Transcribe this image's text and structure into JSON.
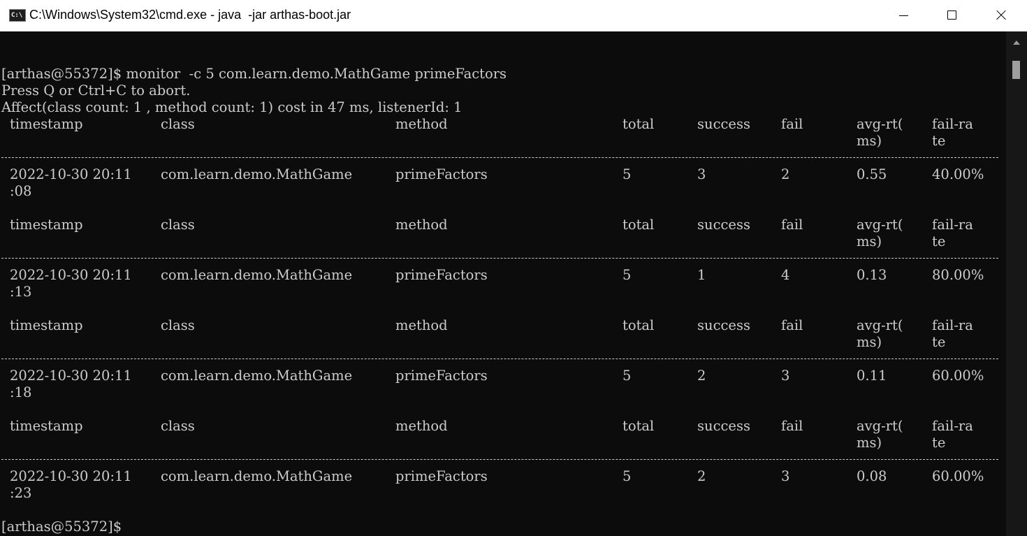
{
  "window": {
    "title": "C:\\Windows\\System32\\cmd.exe - java  -jar arthas-boot.jar",
    "icon": "cmd-icon",
    "icon_text": "C:\\"
  },
  "console": {
    "command_line": "[arthas@55372]$ monitor  -c 5 com.learn.demo.MathGame primeFactors",
    "abort_hint": "Press Q or Ctrl+C to abort.",
    "affect_line": "Affect(class count: 1 , method count: 1) cost in 47 ms, listenerId: 1",
    "headers": [
      "timestamp",
      "class",
      "method",
      "total",
      "success",
      "fail",
      "avg-rt(",
      "fail-ra"
    ],
    "headers_wrap": [
      "",
      "",
      "",
      "",
      "",
      "",
      "ms)",
      "te"
    ],
    "rows": [
      {
        "timestamp": "2022-10-30 20:11",
        "timestamp_wrap": ":08",
        "class": "com.learn.demo.MathGame",
        "method": "primeFactors",
        "total": "5",
        "success": "3",
        "fail": "2",
        "avg_rt": "0.55",
        "fail_rate": "40.00%"
      },
      {
        "timestamp": "2022-10-30 20:11",
        "timestamp_wrap": ":13",
        "class": "com.learn.demo.MathGame",
        "method": "primeFactors",
        "total": "5",
        "success": "1",
        "fail": "4",
        "avg_rt": "0.13",
        "fail_rate": "80.00%"
      },
      {
        "timestamp": "2022-10-30 20:11",
        "timestamp_wrap": ":18",
        "class": "com.learn.demo.MathGame",
        "method": "primeFactors",
        "total": "5",
        "success": "2",
        "fail": "3",
        "avg_rt": "0.11",
        "fail_rate": "60.00%"
      },
      {
        "timestamp": "2022-10-30 20:11",
        "timestamp_wrap": ":23",
        "class": "com.learn.demo.MathGame",
        "method": "primeFactors",
        "total": "5",
        "success": "2",
        "fail": "3",
        "avg_rt": "0.08",
        "fail_rate": "60.00%"
      }
    ],
    "prompt": "[arthas@55372]$"
  },
  "colors": {
    "console_bg": "#0c0c0c",
    "console_text": "#cccccc",
    "titlebar_bg": "#ffffff"
  }
}
